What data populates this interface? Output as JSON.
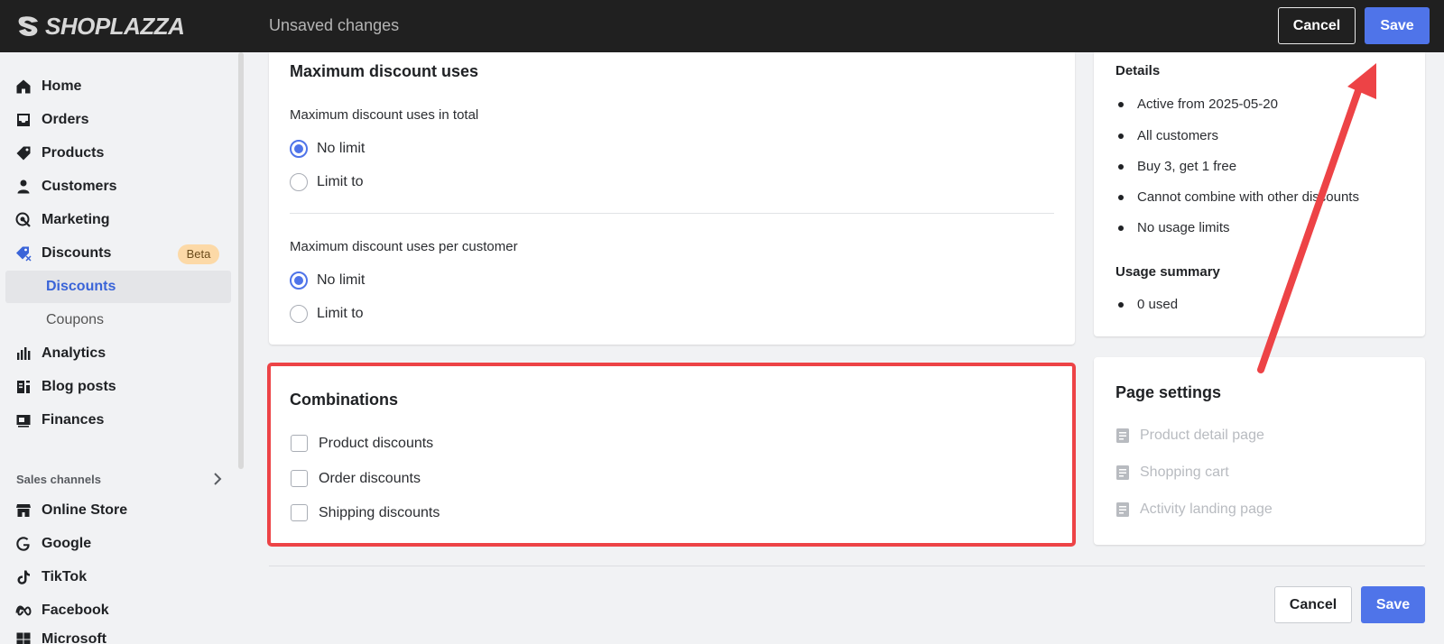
{
  "app": {
    "brand": "SHOPLAZZA",
    "status": "Unsaved changes"
  },
  "toolbar": {
    "cancel_label": "Cancel",
    "save_label": "Save"
  },
  "sidebar": {
    "items": [
      {
        "label": "Home"
      },
      {
        "label": "Orders"
      },
      {
        "label": "Products"
      },
      {
        "label": "Customers"
      },
      {
        "label": "Marketing"
      },
      {
        "label": "Discounts",
        "badge": "Beta"
      },
      {
        "label": "Discounts"
      },
      {
        "label": "Coupons"
      },
      {
        "label": "Analytics"
      },
      {
        "label": "Blog posts"
      },
      {
        "label": "Finances"
      }
    ],
    "sales_channels_label": "Sales channels",
    "channels": [
      {
        "label": "Online Store"
      },
      {
        "label": "Google"
      },
      {
        "label": "TikTok"
      },
      {
        "label": "Facebook"
      },
      {
        "label": "Microsoft"
      }
    ]
  },
  "max_uses": {
    "title": "Maximum discount uses",
    "total_label": "Maximum discount uses in total",
    "per_customer_label": "Maximum discount uses per customer",
    "option_no_limit": "No limit",
    "option_limit_to": "Limit to",
    "total_selected": "No limit",
    "per_customer_selected": "No limit"
  },
  "combinations": {
    "title": "Combinations",
    "options": [
      "Product discounts",
      "Order discounts",
      "Shipping discounts"
    ]
  },
  "details": {
    "title": "Details",
    "bullets": [
      "Active from 2025-05-20",
      "All customers",
      "Buy 3, get 1 free",
      "Cannot combine with other discounts",
      "No usage limits"
    ],
    "usage_title": "Usage summary",
    "usage_bullets": [
      "0 used"
    ]
  },
  "page_settings": {
    "title": "Page settings",
    "items": [
      "Product detail page",
      "Shopping cart",
      "Activity landing page"
    ]
  },
  "colors": {
    "accent": "#4f74e9",
    "annotation": "#ed4346",
    "topbar": "#202020"
  }
}
